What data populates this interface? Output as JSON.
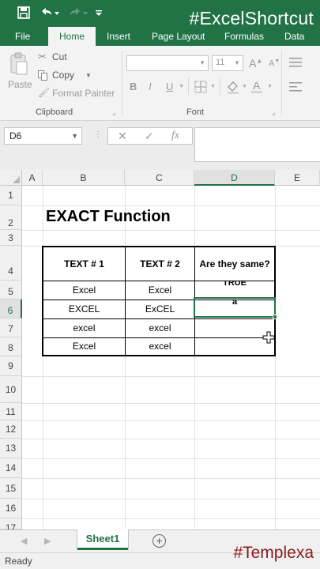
{
  "app": {
    "hashtag_top": "#ExcelShortcut",
    "hashtag_bottom": "#Templexa",
    "accent_color": "#217346",
    "overlay_color": "#8b1a1a"
  },
  "quick_access": {
    "icons": [
      "save-icon",
      "undo-icon",
      "redo-icon",
      "customize-icon"
    ]
  },
  "tabs": [
    {
      "label": "File"
    },
    {
      "label": "Home",
      "active": true
    },
    {
      "label": "Insert"
    },
    {
      "label": "Page Layout"
    },
    {
      "label": "Formulas"
    },
    {
      "label": "Data"
    }
  ],
  "ribbon": {
    "clipboard": {
      "paste_label": "Paste",
      "cut_label": "Cut",
      "copy_label": "Copy",
      "format_painter_label": "Format Painter",
      "group_label": "Clipboard"
    },
    "font": {
      "font_name": "",
      "font_size": "11",
      "bold": "B",
      "italic": "I",
      "underline": "U",
      "grow": "A",
      "shrink": "A",
      "group_label": "Font"
    }
  },
  "formula_bar": {
    "name_box": "D6",
    "cancel": "✕",
    "enter": "✓",
    "fx": "fx",
    "content": ""
  },
  "grid": {
    "columns": [
      "A",
      "B",
      "C",
      "D",
      "E"
    ],
    "active_column": "D",
    "rows": [
      "1",
      "2",
      "3",
      "4",
      "5",
      "6",
      "7",
      "8",
      "9",
      "10",
      "11",
      "12",
      "13",
      "14",
      "15",
      "16",
      "17"
    ],
    "active_row": "6",
    "title": "EXACT Function",
    "table": {
      "headers": [
        "TEXT # 1",
        "TEXT # 2",
        "Are they same?"
      ],
      "rows": [
        {
          "text1": "Excel",
          "text2": "Excel",
          "result": "TRUE"
        },
        {
          "text1": "EXCEL",
          "text2": "ExCEL",
          "result": "a"
        },
        {
          "text1": "excel",
          "text2": "excel",
          "result": ""
        },
        {
          "text1": "Excel",
          "text2": "excel",
          "result": ""
        }
      ]
    }
  },
  "sheets": {
    "tabs": [
      "Sheet1"
    ],
    "active": "Sheet1",
    "add_label": "+"
  },
  "status": {
    "text": "Ready"
  }
}
